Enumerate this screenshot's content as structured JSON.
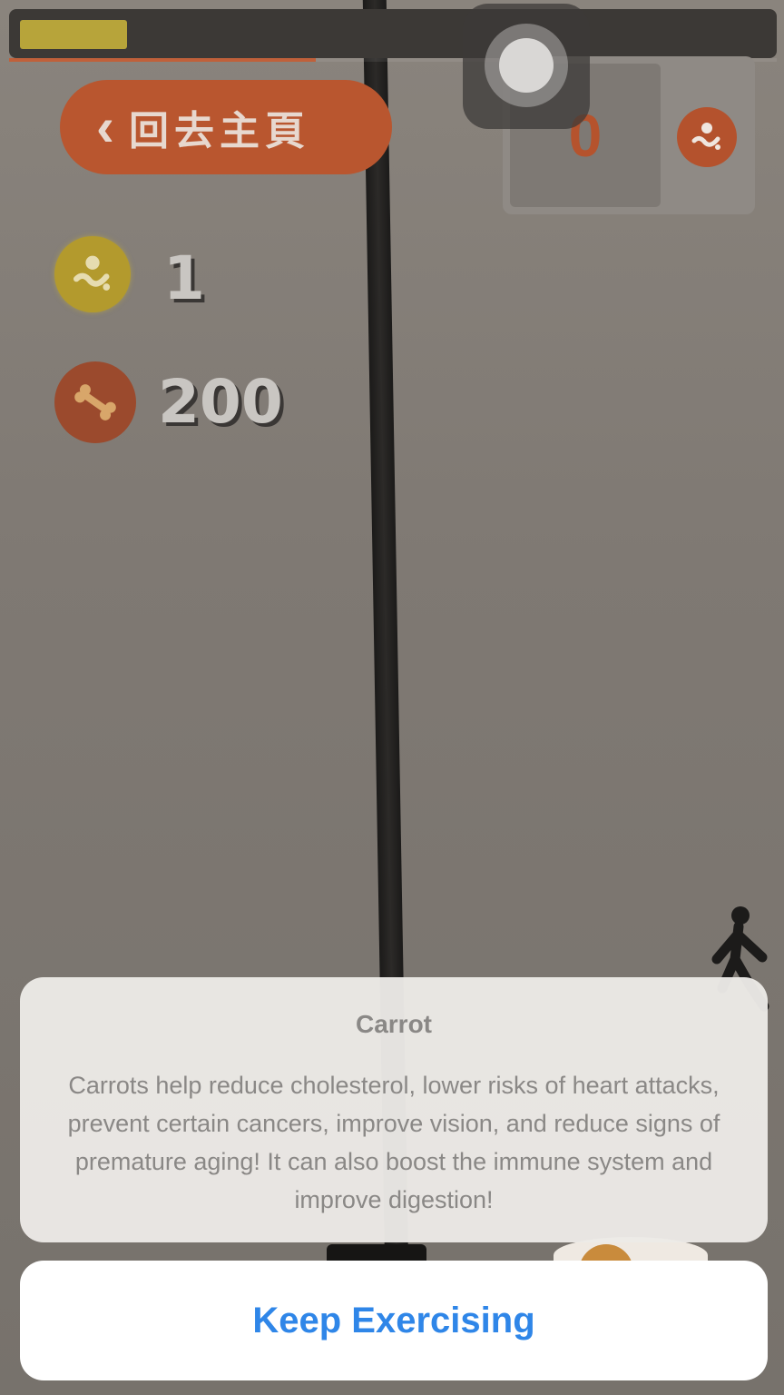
{
  "top_bar": {
    "energy_level": 0.14,
    "progress_level": 0.4
  },
  "back_button": {
    "chevron": "‹",
    "label": "回去主頁"
  },
  "score_card": {
    "count": "0",
    "badge_icon": "paw-badge-icon"
  },
  "stats": {
    "coin_icon": "coin-paw-icon",
    "coin_count": "1",
    "bone_icon": "bone-icon",
    "bone_count": "200"
  },
  "alert": {
    "title": "Carrot",
    "message": "Carrots help reduce cholesterol, lower risks of heart attacks, prevent certain cancers, improve vision, and reduce signs of premature aging! It can also boost the immune system and improve digestion!",
    "action_label": "Keep Exercising"
  },
  "colors": {
    "accent": "#b9562f",
    "action_blue": "#2f86e8",
    "coin": "#b39a2d"
  }
}
